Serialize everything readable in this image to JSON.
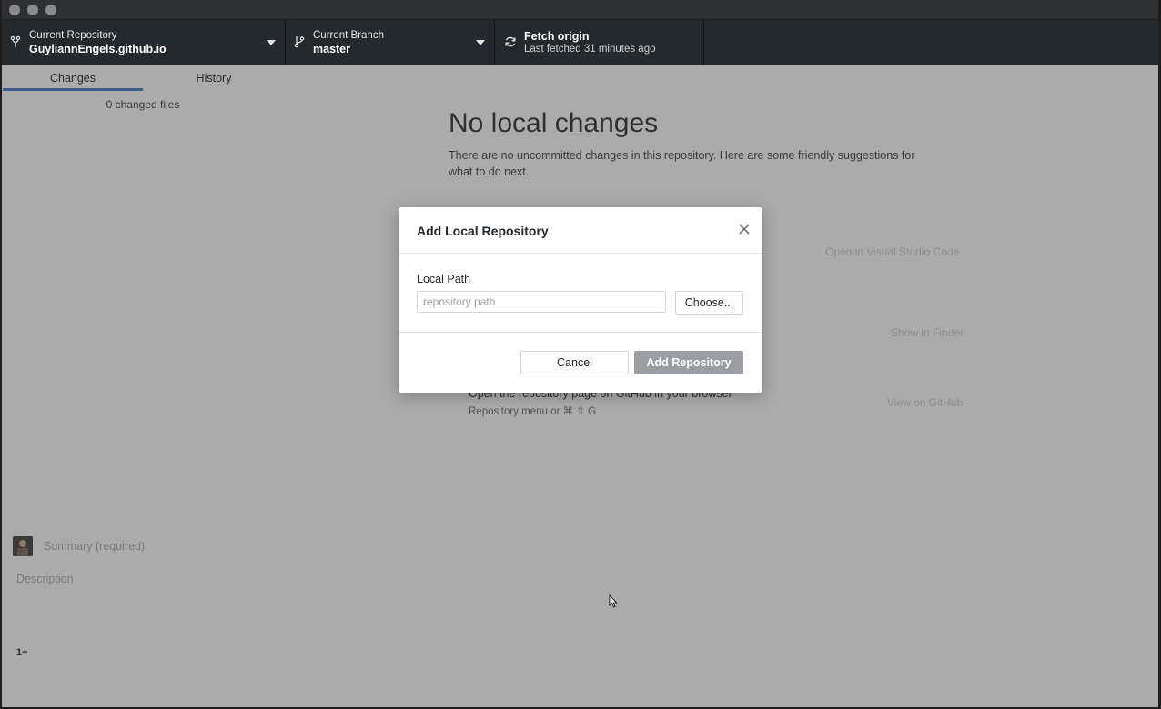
{
  "toolbar": {
    "repository": {
      "label": "Current Repository",
      "value": "GuyliannEngels.github.io"
    },
    "branch": {
      "label": "Current Branch",
      "value": "master"
    },
    "fetch": {
      "label": "Fetch origin",
      "sub": "Last fetched 31 minutes ago"
    }
  },
  "tabs": [
    {
      "label": "Changes",
      "active": true
    },
    {
      "label": "History",
      "active": false
    }
  ],
  "changes": {
    "count_text": "0 changed files"
  },
  "blank_slate": {
    "title": "No local changes",
    "description": "There are no uncommitted changes in this repository. Here are some friendly suggestions for what to do next.",
    "action_editor": "Open in Visual Studio Code",
    "action_finder": "Show in Finder",
    "action_github": "View on GitHub",
    "suggestion_title": "Open the repository page on GitHub in your browser",
    "suggestion_sub": "Repository menu or ⌘ ⇧ G"
  },
  "commit": {
    "summary_placeholder": "Summary (required)",
    "description_placeholder": "Description",
    "coauthor_label": "1+"
  },
  "dialog": {
    "title": "Add Local Repository",
    "path_label": "Local Path",
    "path_placeholder": "repository path",
    "path_value": "",
    "choose_label": "Choose...",
    "cancel_label": "Cancel",
    "submit_label": "Add Repository"
  },
  "colors": {
    "toolbar_bg": "#24292e",
    "overlay_bg": "#ababab",
    "tab_active": "#3f5c8c",
    "primary_disabled": "#9a9ea3"
  }
}
